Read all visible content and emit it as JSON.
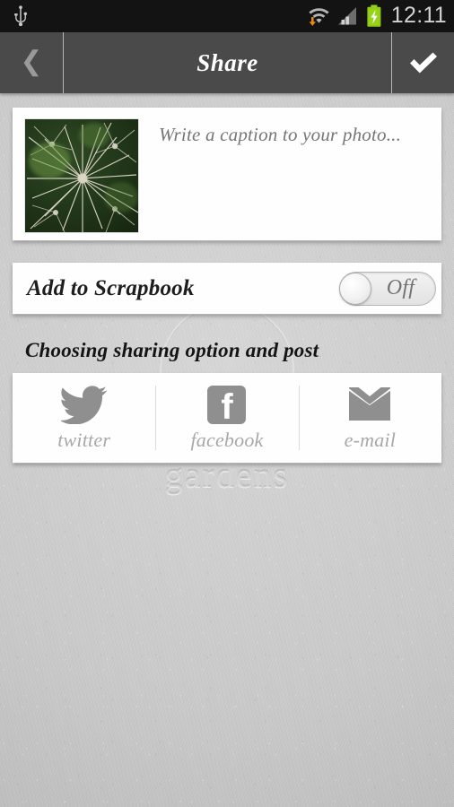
{
  "statusbar": {
    "usb_icon": "usb-icon",
    "wifi_icon": "wifi-download-icon",
    "signal_icon": "cellular-signal-icon",
    "battery_icon": "battery-charging-icon",
    "time": "12:11",
    "colors": {
      "background": "#131313",
      "text": "#d2d2d2",
      "battery": "#97d318",
      "download_arrow": "#e98a12"
    }
  },
  "actionbar": {
    "back_icon": "chevron-left-icon",
    "title": "Share",
    "confirm_icon": "check-icon",
    "colors": {
      "background": "#4a4a4a",
      "title": "#ffffff",
      "divider": "#b9b9b9"
    }
  },
  "caption_card": {
    "thumbnail_name": "photo-thumbnail",
    "thumbnail_alt": "allium seedhead on dark green foliage",
    "placeholder": "Write a caption to your photo...",
    "value": ""
  },
  "scrapbook": {
    "label": "Add to Scrapbook",
    "toggle_state": "Off",
    "toggle_on": false
  },
  "share_section": {
    "header": "Choosing sharing option and post",
    "options": [
      {
        "label": "twitter",
        "icon": "twitter-bird-icon"
      },
      {
        "label": "facebook",
        "icon": "facebook-f-icon"
      },
      {
        "label": "e-mail",
        "icon": "envelope-icon"
      }
    ]
  },
  "background": {
    "watermark_text": "gardens",
    "watermark_shape": "circle-emboss",
    "color": "#c9c9c9"
  }
}
